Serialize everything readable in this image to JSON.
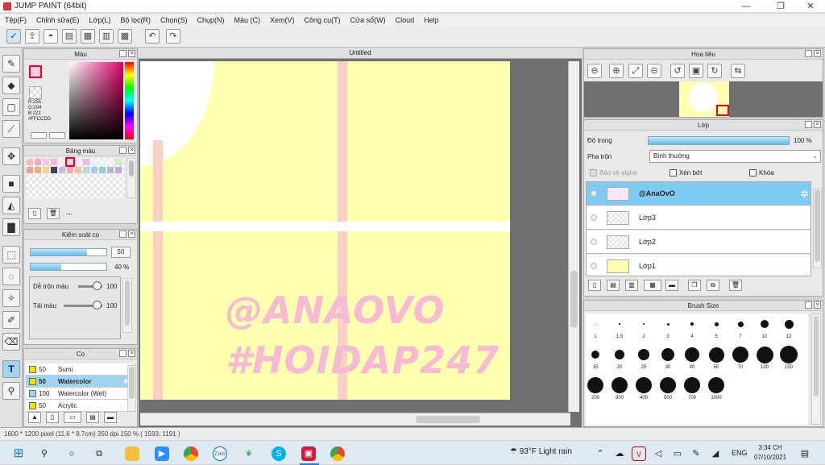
{
  "window": {
    "title": "JUMP PAINT (64bit)",
    "min": "—",
    "max": "❐",
    "close": "✕"
  },
  "menu": [
    "Tệp(F)",
    "Chỉnh sửa(E)",
    "Lớp(L)",
    "Bộ lọc(R)",
    "Chọn(S)",
    "Chụp(N)",
    "Màu (C)",
    "Xem(V)",
    "Công cụ(T)",
    "Cửa sổ(W)",
    "Cloud",
    "Help"
  ],
  "color_panel": {
    "title": "Màu",
    "r": "R:255",
    "g": "G:204",
    "b": "B:221",
    "hex": "#FFCCDD"
  },
  "palette_panel": {
    "title": "Bảng màu",
    "more": "---"
  },
  "brush_control": {
    "title": "Kiểm soát cọ",
    "size": "50",
    "opacity": "40 %",
    "blend_label": "Dễ trộn màu",
    "blend_val": "100",
    "amount_label": "Tải màu",
    "amount_val": "100",
    "size_pct": 0.74,
    "opacity_pct": 0.4
  },
  "brush_panel": {
    "title": "Cọ",
    "items": [
      {
        "size": "50",
        "name": "Sumi",
        "color": "#f2e000"
      },
      {
        "size": "50",
        "name": "Watercolor",
        "color": "#f2e000"
      },
      {
        "size": "100",
        "name": "Watercolor (Wet)",
        "color": "#9fd3ee"
      },
      {
        "size": "50",
        "name": "Acrylic",
        "color": "#f2e000"
      }
    ]
  },
  "canvas": {
    "tab": "Untitled",
    "watermark1": "@ANAOVO",
    "watermark2": "#HOIDAP247"
  },
  "navigator": {
    "title": "Hoa tiêu"
  },
  "layers": {
    "title": "Lớp",
    "opacity_label": "Độ trong",
    "opacity_val": "100 %",
    "blend_label": "Pha trộn",
    "blend_val": "Bình thường",
    "protect_alpha": "Bảo vệ alpha",
    "clip": "Xén bớt",
    "lock": "Khóa",
    "items": [
      {
        "name": "@AnaOvO"
      },
      {
        "name": "Lớp3"
      },
      {
        "name": "Lớp2"
      },
      {
        "name": "Lớp1"
      }
    ]
  },
  "brush_size": {
    "title": "Brush Size",
    "sizes": [
      "1",
      "1.5",
      "2",
      "3",
      "4",
      "5",
      "7",
      "10",
      "12",
      "15",
      "20",
      "25",
      "30",
      "40",
      "50",
      "70",
      "100",
      "150",
      "200",
      "300",
      "400",
      "500",
      "700",
      "1000"
    ]
  },
  "status": {
    "text": "1600 * 1200 pixel   (11.6 * 8.7cm)   350 dpi   150 %   ( 1593, 1191 )"
  },
  "taskbar": {
    "weather": "93°F  Light rain",
    "lang": "ENG",
    "time": "3:34 CH",
    "date": "07/10/2021"
  }
}
